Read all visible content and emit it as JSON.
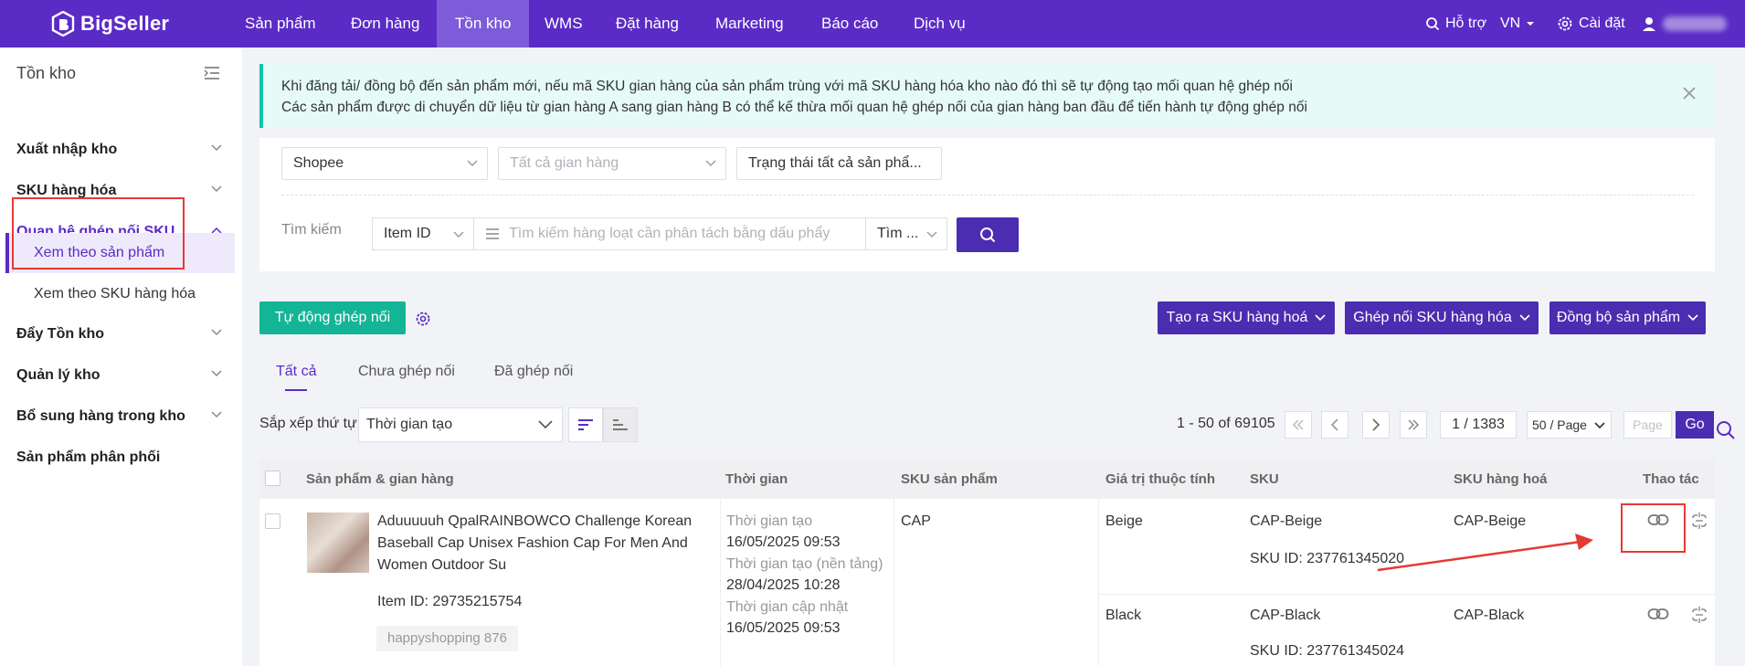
{
  "brand": {
    "name": "BigSeller"
  },
  "nav": {
    "items": [
      "Sản phẩm",
      "Đơn hàng",
      "Tồn kho",
      "WMS",
      "Đặt hàng",
      "Marketing",
      "Báo cáo",
      "Dịch vụ"
    ],
    "help": "Hỗ trợ",
    "lang": "VN",
    "settings": "Cài đặt"
  },
  "sidebar": {
    "title": "Tồn kho",
    "items": [
      "Xuất nhập kho",
      "SKU hàng hóa",
      "Quan hệ ghép nối SKU",
      "Đẩy Tồn kho",
      "Quản lý kho",
      "Bổ sung hàng trong kho",
      "Sản phẩm phân phối"
    ],
    "sub": [
      "Xem theo sản phẩm",
      "Xem theo SKU hàng hóa"
    ]
  },
  "notice": {
    "line1": "Khi đăng tải/ đồng bộ đến sản phẩm mới, nếu mã SKU gian hàng của sản phẩm trùng với mã SKU hàng hóa kho nào đó thì sẽ tự động tạo mối quan hệ ghép nối",
    "line2": "Các sản phẩm được di chuyển dữ liệu từ gian hàng A sang gian hàng B có thể kế thừa mối quan hệ ghép nối của gian hàng ban đầu để tiến hành tự động ghép nối"
  },
  "filters": {
    "platform": "Shopee",
    "store_placeholder": "Tất cả gian hàng",
    "status": "Trạng thái tất cả sản phẩ...",
    "search_label": "Tìm kiếm",
    "search_field": "Item ID",
    "search_placeholder": "Tìm kiếm hàng loạt cần phân tách bằng dấu phẩy",
    "search_mode": "Tìm ..."
  },
  "toolbar": {
    "auto_match": "Tự động ghép nối",
    "create_sku": "Tạo ra SKU hàng hoá",
    "match_sku": "Ghép nối SKU hàng hóa",
    "sync": "Đồng bộ sản phẩm"
  },
  "tabs": [
    "Tất cả",
    "Chưa ghép nối",
    "Đã ghép nối"
  ],
  "sort": {
    "label": "Sắp xếp thứ tự",
    "value": "Thời gian tạo"
  },
  "pagination": {
    "range": "1 - 50 of 69105",
    "page": "1 / 1383",
    "page_size": "50 / Page",
    "page_placeholder": "Page",
    "go": "Go"
  },
  "table": {
    "headers": [
      "Sản phẩm & gian hàng",
      "Thời gian",
      "SKU sản phẩm",
      "Giá trị thuộc tính",
      "SKU",
      "SKU hàng hoá",
      "Thao tác"
    ],
    "product": {
      "title": "Aduuuuuh QpalRAINBOWCO Challenge Korean Baseball Cap Unisex Fashion Cap For Men And Women Outdoor Su",
      "item_id": "Item ID: 29735215754",
      "shop": "happyshopping 876",
      "created_label": "Thời gian tạo",
      "created": "16/05/2025 09:53",
      "platform_created_label": "Thời gian tạo (nền tảng)",
      "platform_created": "28/04/2025 10:28",
      "updated_label": "Thời gian cập nhật",
      "updated": "16/05/2025 09:53",
      "sku": "CAP"
    },
    "variants": [
      {
        "attr": "Beige",
        "sku": "CAP-Beige",
        "sku_id": "SKU ID: 237761345020",
        "warehouse_sku": "CAP-Beige"
      },
      {
        "attr": "Black",
        "sku": "CAP-Black",
        "sku_id": "SKU ID: 237761345024",
        "warehouse_sku": "CAP-Black"
      }
    ]
  },
  "colors": {
    "primary": "#5b2bc6",
    "green": "#13b596",
    "highlight": "#e53935"
  }
}
